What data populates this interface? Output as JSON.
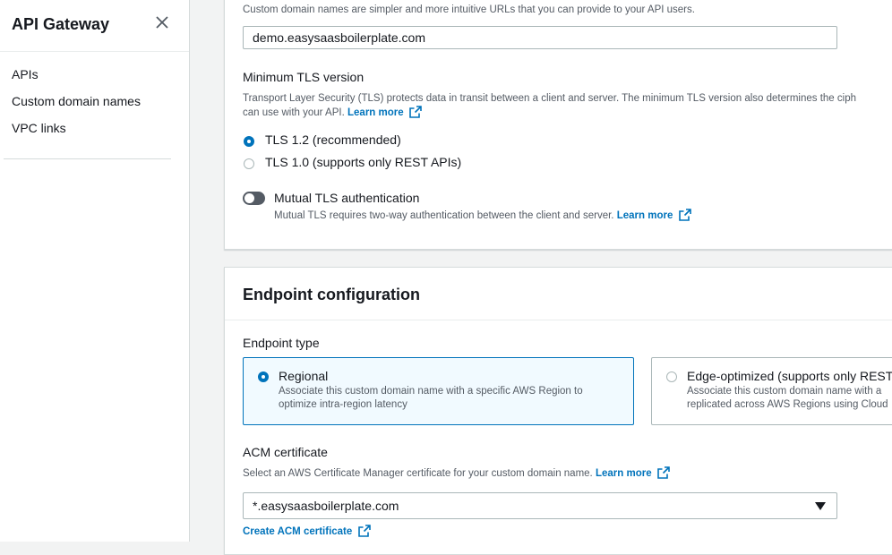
{
  "sidebar": {
    "title": "API Gateway",
    "items": [
      {
        "label": "APIs"
      },
      {
        "label": "Custom domain names"
      },
      {
        "label": "VPC links"
      }
    ]
  },
  "domain_section": {
    "description": "Custom domain names are simpler and more intuitive URLs that you can provide to your API users.",
    "domain_value": "demo.easysaasboilerplate.com"
  },
  "tls": {
    "label": "Minimum TLS version",
    "description_line1": "Transport Layer Security (TLS) protects data in transit between a client and server. The minimum TLS version also determines the ciph",
    "description_line2": "can use with your API.",
    "learn_more": "Learn more",
    "options": [
      {
        "label": "TLS 1.2 (recommended)",
        "selected": true
      },
      {
        "label": "TLS 1.0 (supports only REST APIs)",
        "selected": false
      }
    ]
  },
  "mutual_tls": {
    "label": "Mutual TLS authentication",
    "description": "Mutual TLS requires two-way authentication between the client and server.",
    "learn_more": "Learn more",
    "enabled": false
  },
  "endpoint_config": {
    "title": "Endpoint configuration",
    "type_label": "Endpoint type",
    "options": [
      {
        "title": "Regional",
        "description_line1": "Associate this custom domain name with a specific AWS Region to",
        "description_line2": "optimize intra-region latency",
        "selected": true
      },
      {
        "title": "Edge-optimized (supports only REST",
        "description_line1": "Associate this custom domain name with a",
        "description_line2": "replicated across AWS Regions using Cloud",
        "selected": false
      }
    ]
  },
  "acm": {
    "label": "ACM certificate",
    "description": "Select an AWS Certificate Manager certificate for your custom domain name.",
    "learn_more": "Learn more",
    "selected_value": "*.easysaasboilerplate.com",
    "create_link": "Create ACM certificate"
  },
  "colors": {
    "accent": "#0073bb",
    "text": "#16191f",
    "muted": "#545b64",
    "background": "#f2f3f3"
  },
  "icons": [
    "close-icon",
    "external-link-icon",
    "caret-down-icon"
  ]
}
